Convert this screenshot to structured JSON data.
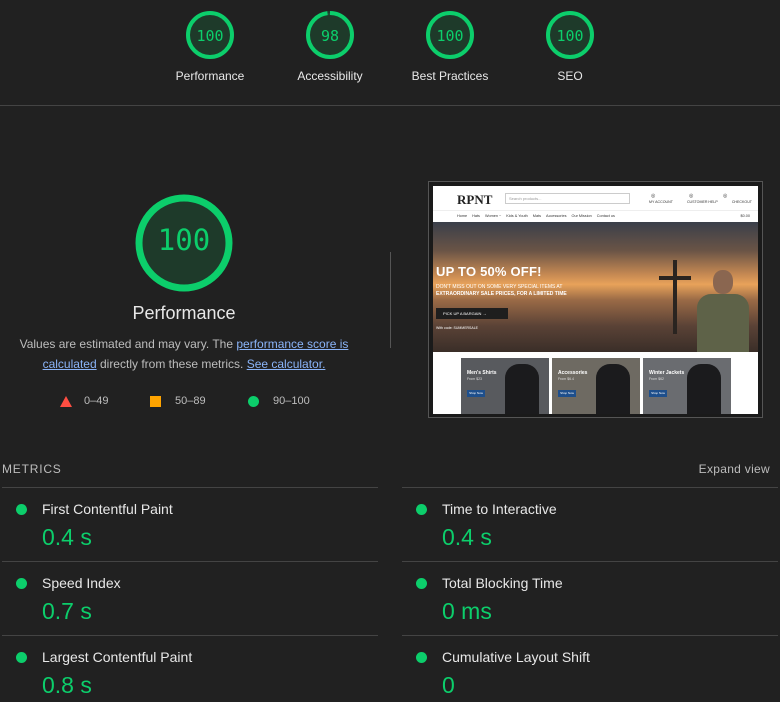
{
  "categories": [
    {
      "label": "Performance",
      "score": "100",
      "fraction": 1.0
    },
    {
      "label": "Accessibility",
      "score": "98",
      "fraction": 0.98
    },
    {
      "label": "Best Practices",
      "score": "100",
      "fraction": 1.0
    },
    {
      "label": "SEO",
      "score": "100",
      "fraction": 1.0
    }
  ],
  "performance": {
    "score": "100",
    "title": "Performance",
    "desc_prefix": "Values are estimated and may vary. The ",
    "desc_link1": "performance score is calculated",
    "desc_middle": " directly from these metrics. ",
    "desc_link2": "See calculator."
  },
  "legend": {
    "fail": "0–49",
    "average": "50–89",
    "pass": "90–100"
  },
  "colors": {
    "pass": "#0cce6b",
    "average": "#ffa400",
    "fail": "#ff4e42",
    "background": "#212121"
  },
  "screenshot": {
    "logo": "RPNT",
    "search_placeholder": "Search products...",
    "header_links": [
      "MY ACCOUNT",
      "CUSTOMER HELP",
      "CHECKOUT"
    ],
    "nav": [
      "Home",
      "Hats",
      "Women ~",
      "Kids & Youth",
      "Mats",
      "Accessories",
      "Our Mission",
      "Contact us"
    ],
    "cart": "$0.00",
    "hero_title": "UP TO 50% OFF!",
    "hero_sub1": "DON'T MISS OUT ON SOME VERY SPECIAL ITEMS AT",
    "hero_sub2": "EXTRAORDINARY SALE PRICES, FOR A LIMITED TIME",
    "hero_button": "PICK UP A BARGAIN →",
    "hero_small": "With code: SUMMERSALE",
    "cards": [
      {
        "title": "Men's Shirts",
        "sub": "From $23",
        "button": "Shop Now"
      },
      {
        "title": "Accessories",
        "sub": "From $6.4",
        "button": "Shop Now"
      },
      {
        "title": "Winter Jackets",
        "sub": "From $62",
        "button": "Shop Now"
      }
    ]
  },
  "metrics_section": {
    "label": "METRICS",
    "expand": "Expand view",
    "items": [
      {
        "name": "First Contentful Paint",
        "value": "0.4 s"
      },
      {
        "name": "Time to Interactive",
        "value": "0.4 s"
      },
      {
        "name": "Speed Index",
        "value": "0.7 s"
      },
      {
        "name": "Total Blocking Time",
        "value": "0 ms"
      },
      {
        "name": "Largest Contentful Paint",
        "value": "0.8 s"
      },
      {
        "name": "Cumulative Layout Shift",
        "value": "0"
      }
    ]
  }
}
